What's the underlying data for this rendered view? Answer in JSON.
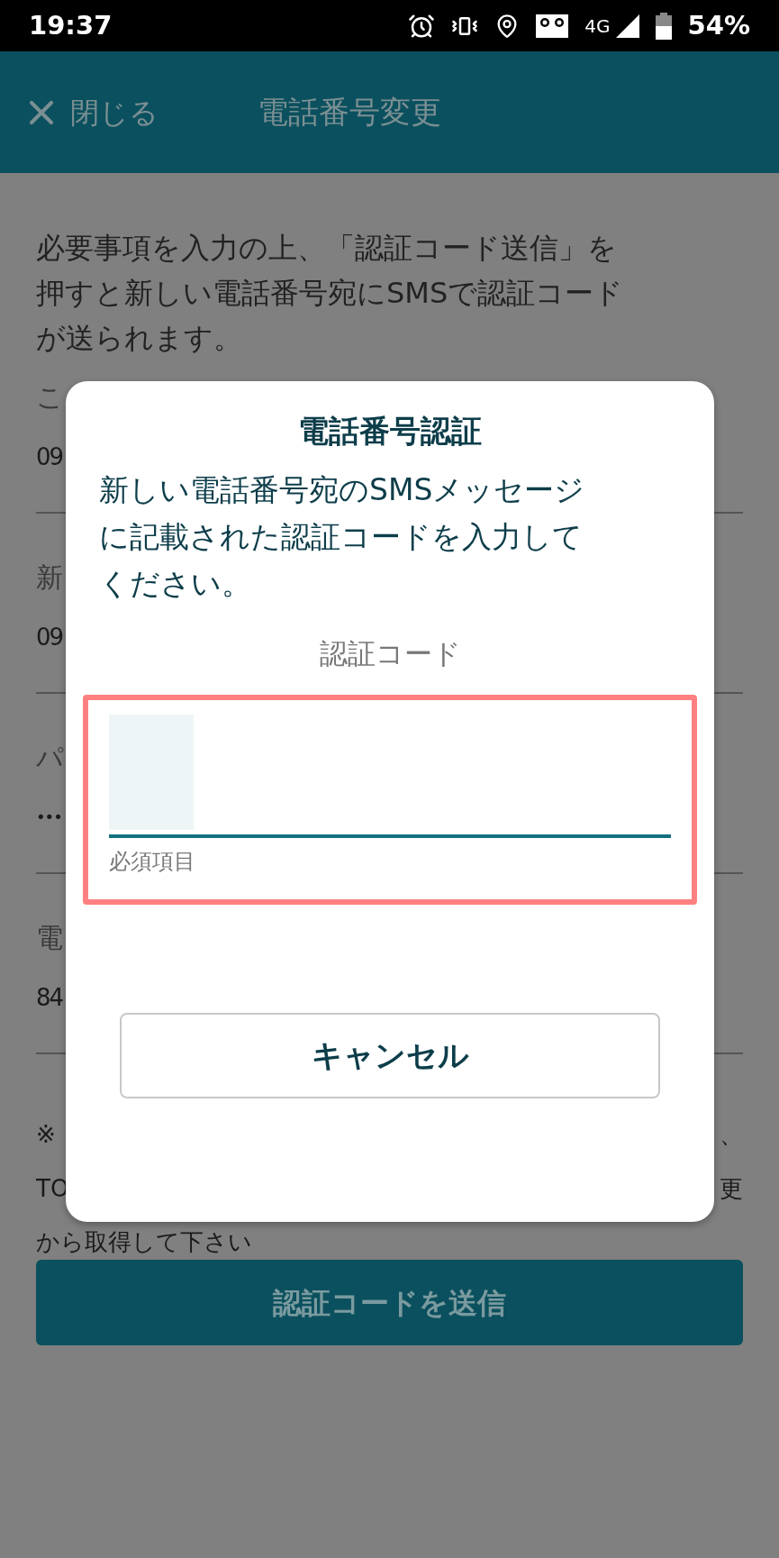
{
  "status_bar": {
    "time": "19:37",
    "network": "4G",
    "battery": "54%"
  },
  "header": {
    "close_label": "閉じる",
    "title": "電話番号変更"
  },
  "intro_lines": [
    "必要事項を入力の上、「認証コード送信」を",
    "押すと新しい電話番号宛にSMSで認証コード",
    "が送られます。"
  ],
  "fields": [
    {
      "label": "こ",
      "value": "09"
    },
    {
      "label": "新",
      "value": "09"
    },
    {
      "label": "パ",
      "value": "•••"
    },
    {
      "label": "電",
      "value": "84"
    }
  ],
  "note": {
    "line_1_start": "※",
    "line_1_end": "、",
    "line_2_start": "TO",
    "line_2_end": "更",
    "line_3": "から取得して下さい"
  },
  "send_button": "認証コードを送信",
  "dialog": {
    "title": "電話番号認証",
    "message_lines": [
      "新しい電話番号宛のSMSメッセージ",
      "に記載された認証コードを入力して",
      "ください。"
    ],
    "field_label": "認証コード",
    "highlighted": true,
    "helper": "必須項目",
    "cancel": "キャンセル"
  }
}
